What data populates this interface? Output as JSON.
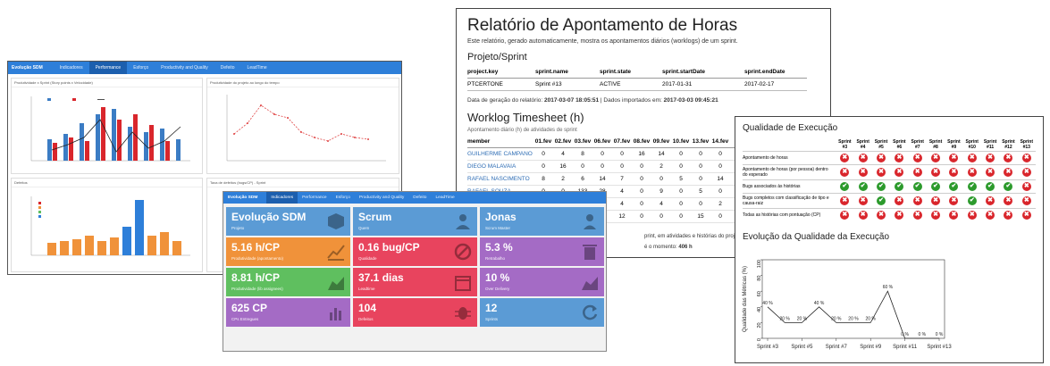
{
  "dashboard": {
    "brand": "Evolução SDM",
    "nav": [
      "Indicadores",
      "Performance",
      "Esforço",
      "Productivity and Quality",
      "Defeito",
      "LeadTime"
    ],
    "active_nav": 2,
    "charts": [
      {
        "title": "Produtividade x Sprint (Story points x Velocidade)"
      },
      {
        "title": "Produtividade do projeto ao longo do tempo"
      },
      {
        "title": "Defeitos"
      },
      {
        "title": "Taxa de defeitos (bugs/CP) - Sprint"
      }
    ]
  },
  "report": {
    "title": "Relatório de Apontamento de Horas",
    "description": "Este relatório, gerado automaticamente, mostra os apontamentos diários (worklogs) de um sprint.",
    "project_heading": "Projeto/Sprint",
    "project_columns": [
      "project.key",
      "sprint.name",
      "sprint.state",
      "sprint.startDate",
      "sprint.endDate"
    ],
    "project_row": [
      "PTCERTONE",
      "Sprint #13",
      "ACTIVE",
      "2017-01-31",
      "2017-02-17"
    ],
    "generated_label": "Data de geração do relatório:",
    "generated_value": "2017-03-07 18:05:51",
    "imported_label": "| Dados importados em:",
    "imported_value": "2017-03-03 09:45:21",
    "worklog_heading": "Worklog Timesheet (h)",
    "worklog_sub": "Apontamento diário (h) de atividades de sprint",
    "worklog_columns": [
      "member",
      "01.fev",
      "02.fev",
      "03.fev",
      "06.fev",
      "07.fev",
      "08.fev",
      "09.fev",
      "10.fev",
      "13.fev",
      "14.fev",
      "15"
    ],
    "worklog_rows": [
      [
        "GUILHERME CAMPANO",
        "0",
        "4",
        "8",
        "0",
        "0",
        "16",
        "14",
        "0",
        "0",
        "0",
        ""
      ],
      [
        "DIEGO MALAVAIA",
        "0",
        "16",
        "0",
        "0",
        "0",
        "0",
        "2",
        "0",
        "0",
        "0",
        ""
      ],
      [
        "RAFAEL NASCIMENTO",
        "8",
        "2",
        "6",
        "14",
        "7",
        "0",
        "0",
        "5",
        "0",
        "14",
        ""
      ],
      [
        "RAFAEL SOUZA",
        "0",
        "0",
        "133",
        "28",
        "4",
        "0",
        "9",
        "0",
        "5",
        "0",
        ""
      ],
      [
        "",
        "",
        "",
        "",
        "7",
        "4",
        "0",
        "4",
        "0",
        "0",
        "2",
        ""
      ],
      [
        "",
        "",
        "",
        "",
        "0",
        "12",
        "0",
        "0",
        "0",
        "15",
        "0",
        ""
      ]
    ],
    "footer_1": "print, em atividades e histórias do projeto.",
    "footer_2": "é o momento:",
    "footer_2_value": "406 h"
  },
  "indicators": {
    "brand": "Evolução SDM",
    "nav": [
      "Indicadores",
      "Performance",
      "Esforço",
      "Productivity and Quality",
      "Defeito",
      "LeadTime"
    ],
    "active_nav": 0,
    "tiles": [
      {
        "value": "Evolução SDM",
        "label": "Projeto",
        "color": "#5b9bd5",
        "icon": "cube-icon"
      },
      {
        "value": "Scrum",
        "label": "Quem",
        "color": "#5b9bd5",
        "icon": "user-icon"
      },
      {
        "value": "Jonas",
        "label": "Scrum Master",
        "color": "#5b9bd5",
        "icon": "person-icon"
      },
      {
        "value": "5.16 h/CP",
        "label": "Produtividade (apontamento)",
        "color": "#f0923a",
        "icon": "trend-icon"
      },
      {
        "value": "0.16 bug/CP",
        "label": "Qualidade",
        "color": "#e8445e",
        "icon": "ban-icon"
      },
      {
        "value": "5.3 %",
        "label": "Retrabalho",
        "color": "#a46bc5",
        "icon": "trash-icon"
      },
      {
        "value": "8.81 h/CP",
        "label": "Produtividade (lib assignees)",
        "color": "#5fbf5f",
        "icon": "area-chart-icon"
      },
      {
        "value": "37.1 dias",
        "label": "Leadtime",
        "color": "#e8445e",
        "icon": "calendar-icon"
      },
      {
        "value": "10 %",
        "label": "Over Delivery",
        "color": "#a46bc5",
        "icon": "area-chart-icon"
      },
      {
        "value": "625 CP",
        "label": "CPs Entregues",
        "color": "#a46bc5",
        "icon": "bar-chart-icon"
      },
      {
        "value": "104",
        "label": "Defeitos",
        "color": "#e8445e",
        "icon": "bug-icon"
      },
      {
        "value": "12",
        "label": "Sprints",
        "color": "#5b9bd5",
        "icon": "refresh-icon"
      }
    ]
  },
  "quality": {
    "title": "Qualidade de Execução",
    "sprints": [
      "Sprint #3",
      "Sprint #4",
      "Sprint #5",
      "Sprint #6",
      "Sprint #7",
      "Sprint #8",
      "Sprint #9",
      "Sprint #10",
      "Sprint #11",
      "Sprint #12",
      "Sprint #13"
    ],
    "rows": [
      {
        "label": "Apontamento de horas",
        "status": [
          "x",
          "x",
          "x",
          "x",
          "x",
          "x",
          "x",
          "x",
          "x",
          "x",
          "x"
        ]
      },
      {
        "label": "Apontamento de horas (por pessoa) dentro do esperado",
        "status": [
          "x",
          "x",
          "x",
          "x",
          "x",
          "x",
          "x",
          "x",
          "x",
          "x",
          "x"
        ]
      },
      {
        "label": "Bugs associados às histórias",
        "status": [
          "ok",
          "ok",
          "ok",
          "ok",
          "ok",
          "ok",
          "ok",
          "ok",
          "ok",
          "ok",
          "x"
        ]
      },
      {
        "label": "Bugs completos com classificação de tipo e causa-raiz",
        "status": [
          "x",
          "x",
          "ok",
          "x",
          "x",
          "x",
          "x",
          "ok",
          "x",
          "x",
          "x"
        ]
      },
      {
        "label": "Todas as histórias com pontuação (CP)",
        "status": [
          "x",
          "x",
          "x",
          "x",
          "x",
          "x",
          "x",
          "x",
          "x",
          "x",
          "x"
        ]
      }
    ],
    "evolution_title": "Evolução da Qualidade da Execução",
    "chart_data": {
      "type": "line",
      "x": [
        "Sprint #3",
        "Sprint #4",
        "Sprint #5",
        "Sprint #6",
        "Sprint #7",
        "Sprint #8",
        "Sprint #9",
        "Sprint #10",
        "Sprint #11",
        "Sprint #12",
        "Sprint #13"
      ],
      "xticks": [
        "Sprint #3",
        "Sprint #5",
        "Sprint #7",
        "Sprint #9",
        "Sprint #11",
        "Sprint #13"
      ],
      "values": [
        40,
        20,
        20,
        40,
        20,
        20,
        20,
        60,
        0,
        0,
        0
      ],
      "labels": [
        "40 %",
        "20 %",
        "20 %",
        "40 %",
        "20 %",
        "20 %",
        "20 %",
        "60 %",
        "0 %",
        "0 %",
        "0 %"
      ],
      "ylabel": "Qualidade das Métricas (%)",
      "ylim": [
        0,
        100
      ],
      "yticks": [
        "0",
        "20",
        "40",
        "60",
        "80",
        "100"
      ]
    }
  },
  "colors": {
    "navbar": "#2e7fd9",
    "fail": "#d9262c",
    "pass": "#2c9a2c"
  }
}
